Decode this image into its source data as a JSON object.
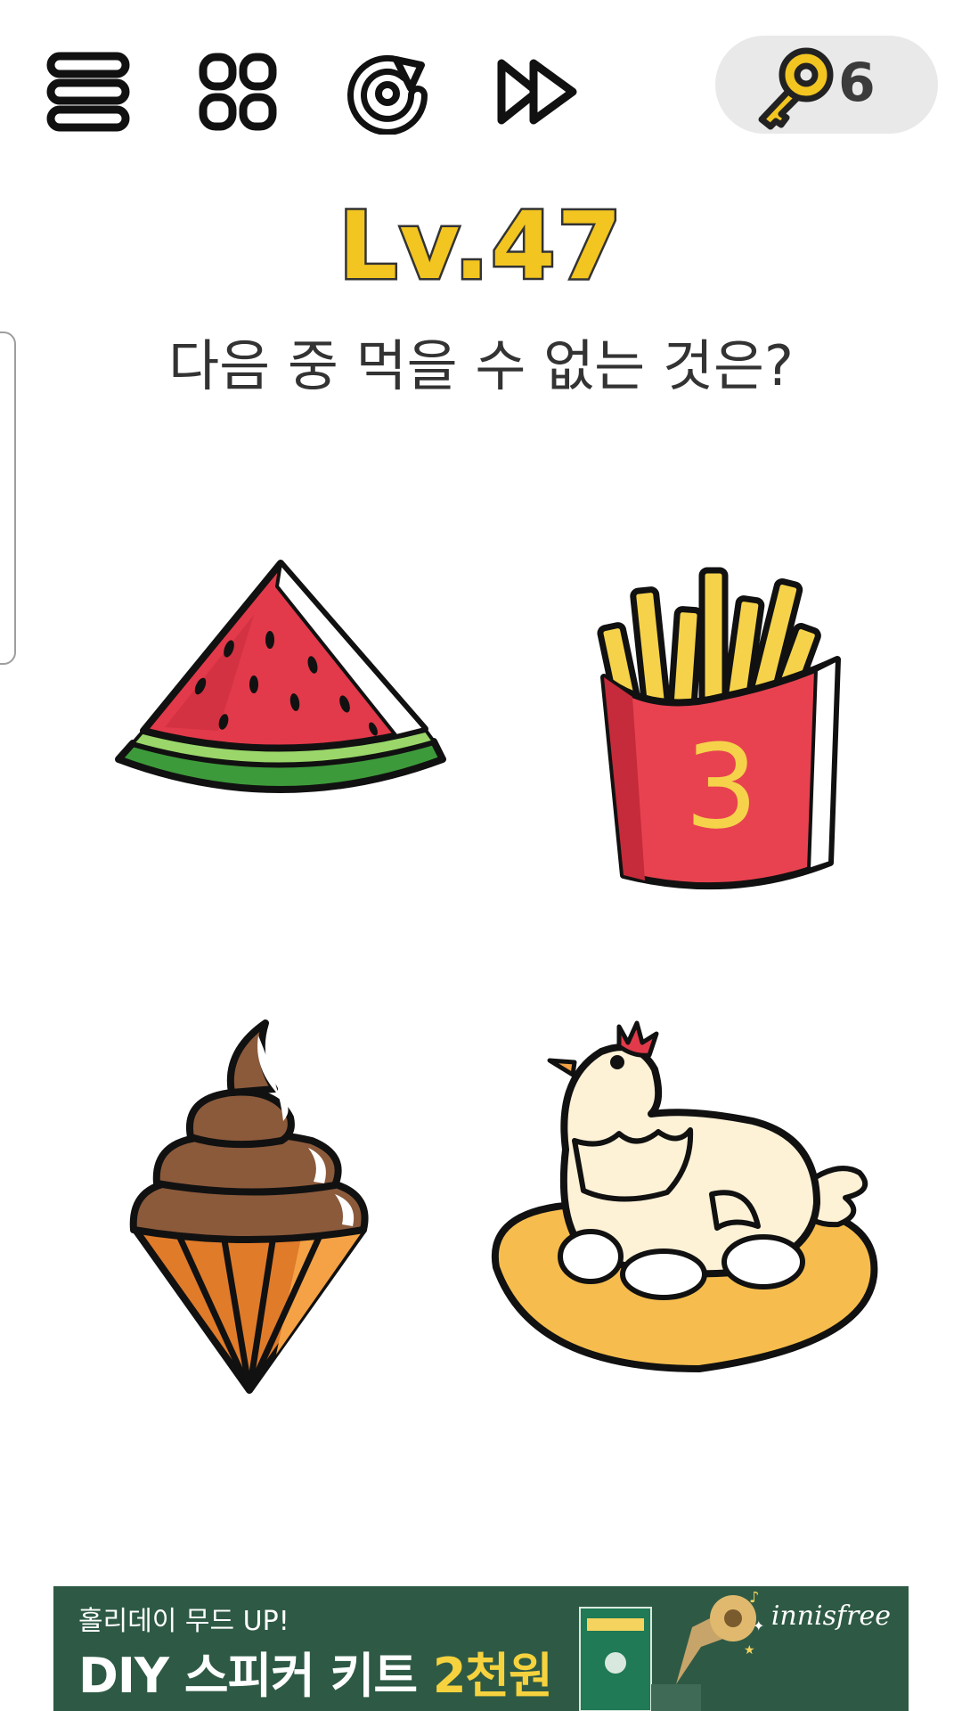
{
  "toolbar": {
    "menu_icon": "menu-icon",
    "levels_icon": "grid-icon",
    "restart_icon": "restart-icon",
    "skip_icon": "fast-forward-icon",
    "keys_icon": "key-icon",
    "keys_count": "6"
  },
  "level": {
    "title": "Lv.47",
    "question": "다음 중 먹을 수 없는 것은?"
  },
  "choices": [
    {
      "icon": "watermelon-icon"
    },
    {
      "icon": "french-fries-icon",
      "box_label": "3"
    },
    {
      "icon": "ice-cream-cone-icon"
    },
    {
      "icon": "hen-on-eggs-icon"
    }
  ],
  "ad": {
    "subtitle": "홀리데이 무드 UP!",
    "title_main": "DIY 스피커 키트 ",
    "title_accent": "2천원",
    "brand": "innisfree"
  },
  "colors": {
    "level_yellow": "#f2c521",
    "ad_green": "#2e5a45",
    "key_gold": "#f2c521",
    "pill_gray": "#e9e9e9"
  }
}
